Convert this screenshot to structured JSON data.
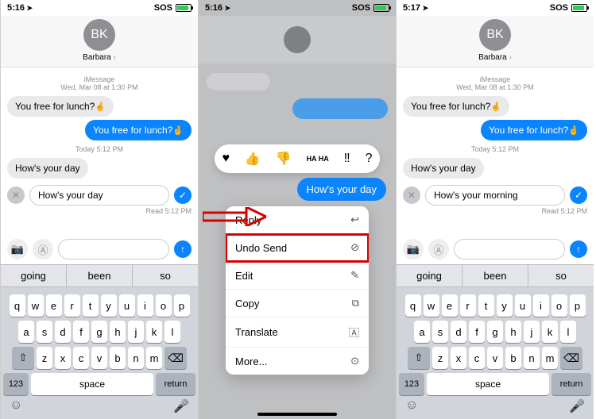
{
  "status_sos": "SOS",
  "phones": [
    {
      "time": "5:16",
      "contact_initials": "BK",
      "contact_name": "Barbara",
      "meta1_label": "iMessage",
      "meta1_time": "Wed, Mar 08 at 1:30 PM",
      "msg_in": "You free for lunch?",
      "msg_out": "You free for lunch?",
      "meta2": "Today 5:12 PM",
      "draft_gray": "How's your day",
      "edit_text": "How's your day ",
      "read": "Read 5:12 PM",
      "suggestions": [
        "going",
        "been",
        "so"
      ]
    },
    {
      "time": "5:16",
      "focus_text": "How's your day",
      "tapbacks": [
        "♥",
        "👍",
        "👎",
        "HA HA",
        "‼",
        "?"
      ],
      "menu": [
        {
          "label": "Reply",
          "icon": "↩"
        },
        {
          "label": "Undo Send",
          "icon": "⊘",
          "highlight": true
        },
        {
          "label": "Edit",
          "icon": "✎"
        },
        {
          "label": "Copy",
          "icon": "⧉"
        },
        {
          "label": "Translate",
          "icon": "🄰"
        },
        {
          "label": "More...",
          "icon": "⊙"
        }
      ]
    },
    {
      "time": "5:17",
      "contact_initials": "BK",
      "contact_name": "Barbara",
      "meta1_label": "iMessage",
      "meta1_time": "Wed, Mar 08 at 1:30 PM",
      "msg_in": "You free for lunch?",
      "msg_out": "You free for lunch?",
      "meta2": "Today 5:12 PM",
      "draft_gray": "How's your day",
      "edit_text": "How's your morning",
      "read": "Read 5:12 PM",
      "suggestions": [
        "going",
        "been",
        "so"
      ]
    }
  ],
  "keyboard": {
    "rows": [
      [
        "q",
        "w",
        "e",
        "r",
        "t",
        "y",
        "u",
        "i",
        "o",
        "p"
      ],
      [
        "a",
        "s",
        "d",
        "f",
        "g",
        "h",
        "j",
        "k",
        "l"
      ],
      [
        "z",
        "x",
        "c",
        "v",
        "b",
        "n",
        "m"
      ]
    ],
    "shift": "⇧",
    "del": "⌫",
    "num": "123",
    "space": "space",
    "return": "return",
    "emoji": "☺",
    "mic": "🎤"
  }
}
